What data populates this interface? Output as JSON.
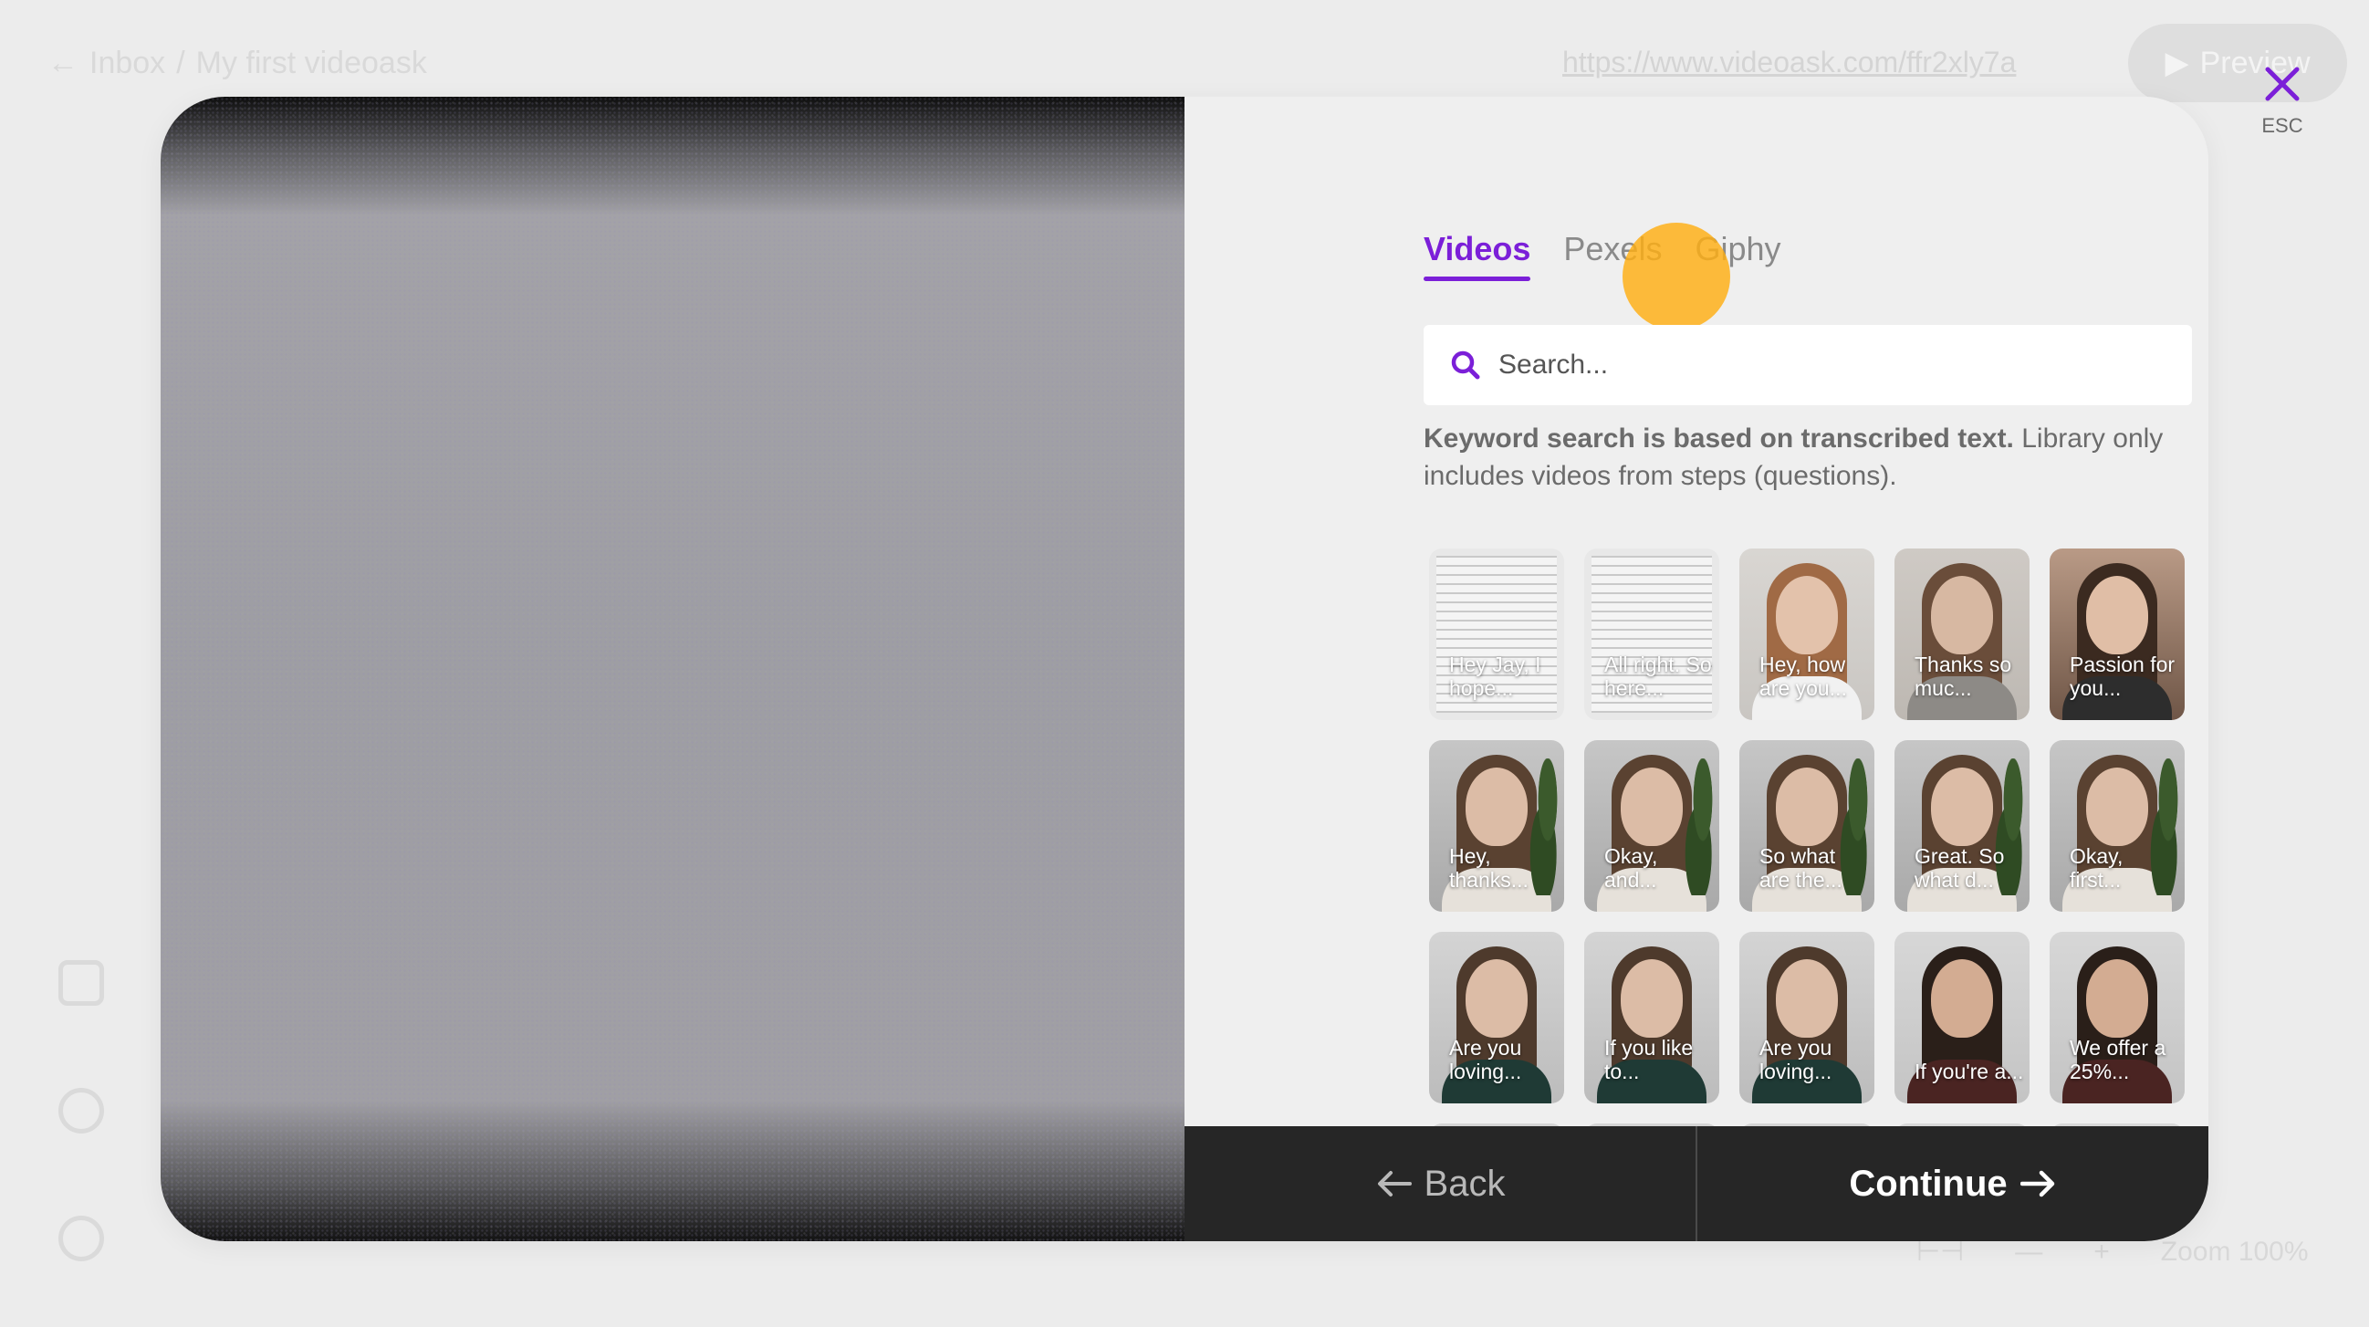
{
  "background": {
    "breadcrumb": {
      "back_label": "Inbox",
      "separator": "/",
      "current": "My first videoask"
    },
    "url": "https://www.videoask.com/ffr2xly7a",
    "preview_label": "Preview",
    "zoom_label": "Zoom 100%"
  },
  "modal": {
    "tabs": [
      {
        "label": "Videos",
        "active": true
      },
      {
        "label": "Pexels",
        "active": false
      },
      {
        "label": "Giphy",
        "active": false
      }
    ],
    "search": {
      "placeholder": "Search..."
    },
    "hint": {
      "bold": "Keyword search is based on transcribed text.",
      "rest": " Library only includes videos from steps (questions)."
    },
    "thumbnails": [
      {
        "caption": "Hey Jay, I hope...",
        "kind": "doc"
      },
      {
        "caption": "All right. So here...",
        "kind": "doc"
      },
      {
        "caption": "Hey, how are you...",
        "kind": "man-light"
      },
      {
        "caption": "Thanks so muc...",
        "kind": "woman-plain"
      },
      {
        "caption": "Passion for you...",
        "kind": "woman-room"
      },
      {
        "caption": "Hey, thanks...",
        "kind": "woman-plant"
      },
      {
        "caption": "Okay, and...",
        "kind": "woman-plant"
      },
      {
        "caption": "So what are the...",
        "kind": "woman-plant"
      },
      {
        "caption": "Great. So what d...",
        "kind": "woman-plant"
      },
      {
        "caption": "Okay, first...",
        "kind": "woman-plant"
      },
      {
        "caption": "Are you loving...",
        "kind": "woman-long"
      },
      {
        "caption": "If you like to...",
        "kind": "woman-long"
      },
      {
        "caption": "Are you loving...",
        "kind": "woman-long"
      },
      {
        "caption": "If you're a...",
        "kind": "man-dark"
      },
      {
        "caption": "We offer a 25%...",
        "kind": "man-dark"
      },
      {
        "caption": "",
        "kind": "woman-long"
      },
      {
        "caption": "",
        "kind": "woman-long"
      },
      {
        "caption": "",
        "kind": "woman-long"
      },
      {
        "caption": "",
        "kind": "man-dark"
      },
      {
        "caption": "",
        "kind": "man-dark"
      }
    ],
    "back_label": "Back",
    "continue_label": "Continue",
    "close_label": "ESC"
  },
  "colors": {
    "accent": "#7b1fd8",
    "bottom_bar": "#262626",
    "cursor_highlight": "#ffae12"
  }
}
